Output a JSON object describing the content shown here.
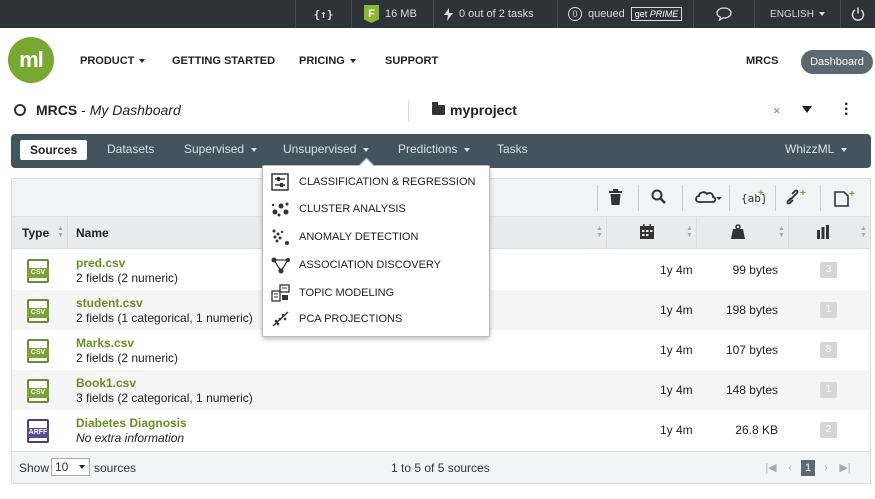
{
  "topbar": {
    "code_label": "{↑}",
    "plan_letter": "F",
    "memory": "16 MB",
    "tasks": "0 out of 2 tasks",
    "queued_count": "0",
    "queued_label": "queued",
    "prime_prefix": "get",
    "prime_word": "PRIME",
    "language": "ENGLISH"
  },
  "header": {
    "logo": "ml",
    "nav": [
      {
        "label": "PRODUCT",
        "has_caret": true
      },
      {
        "label": "GETTING STARTED",
        "has_caret": false
      },
      {
        "label": "PRICING",
        "has_caret": true
      },
      {
        "label": "SUPPORT",
        "has_caret": false
      }
    ],
    "user": "MRCS",
    "dashboard_button": "Dashboard"
  },
  "dashline": {
    "owner": "MRCS",
    "separator": " - ",
    "title": "My Dashboard",
    "project": "myproject",
    "close": "×"
  },
  "tabs": {
    "items": [
      "Sources",
      "Datasets",
      "Supervised",
      "Unsupervised",
      "Predictions",
      "Tasks"
    ],
    "active": "Sources",
    "right": "WhizzML"
  },
  "predictions_menu": [
    {
      "label": "CLASSIFICATION & REGRESSION",
      "icon": "classification-icon"
    },
    {
      "label": "CLUSTER ANALYSIS",
      "icon": "cluster-icon"
    },
    {
      "label": "ANOMALY DETECTION",
      "icon": "anomaly-icon"
    },
    {
      "label": "ASSOCIATION DISCOVERY",
      "icon": "association-icon"
    },
    {
      "label": "TOPIC MODELING",
      "icon": "topic-icon"
    },
    {
      "label": "PCA PROJECTIONS",
      "icon": "pca-icon"
    }
  ],
  "table": {
    "columns": [
      "Type",
      "Name"
    ],
    "rows": [
      {
        "type": "CSV",
        "name": "pred.csv",
        "desc": "2 fields (2 numeric)",
        "age": "1y 4m",
        "size": "99 bytes",
        "count": "3"
      },
      {
        "type": "CSV",
        "name": "student.csv",
        "desc": "2 fields (1 categorical, 1 numeric)",
        "age": "1y 4m",
        "size": "198 bytes",
        "count": "1"
      },
      {
        "type": "CSV",
        "name": "Marks.csv",
        "desc": "2 fields (2 numeric)",
        "age": "1y 4m",
        "size": "107 bytes",
        "count": "8"
      },
      {
        "type": "CSV",
        "name": "Book1.csv",
        "desc": "3 fields (2 categorical, 1 numeric)",
        "age": "1y 4m",
        "size": "148 bytes",
        "count": "1"
      },
      {
        "type": "ARFF",
        "name": "Diabetes Diagnosis",
        "desc": "No extra information",
        "age": "1y 4m",
        "size": "26.8 KB",
        "count": "2"
      }
    ]
  },
  "footer": {
    "show_label": "Show",
    "page_size": "10",
    "sources_label": "sources",
    "range": "1 to 5 of 5 sources",
    "current_page": "1"
  },
  "colors": {
    "accent_green": "#6b8e23",
    "tabbar": "#44545f",
    "topbar": "#2c3339"
  }
}
